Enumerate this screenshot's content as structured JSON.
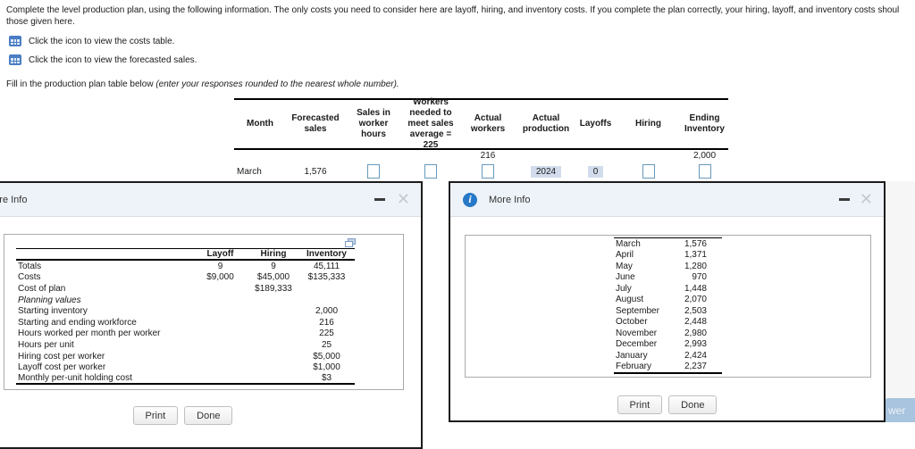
{
  "instructions": {
    "line1": "Complete the level production plan, using the following information. The only costs you need to consider here are layoff, hiring, and inventory costs. If you complete the plan correctly, your hiring, layoff, and inventory costs shoul",
    "line2": "those given here.",
    "costs_link": "Click the icon to view the costs table.",
    "sales_link": "Click the icon to view the forecasted sales.",
    "fill_prefix": "Fill in the production plan table below ",
    "fill_italic": "(enter your responses rounded to the nearest whole number)."
  },
  "production_table": {
    "columns": [
      {
        "label": "Month"
      },
      {
        "label": "Forecasted\nsales"
      },
      {
        "label": "Sales in\nworker\nhours"
      },
      {
        "label": "Workers\nneeded to\nmeet sales\naverage = 225"
      },
      {
        "label": "Actual\nworkers"
      },
      {
        "label": "Actual\nproduction"
      },
      {
        "label": "Layoffs"
      },
      {
        "label": "Hiring"
      },
      {
        "label": "Ending\nInventory"
      }
    ],
    "row": {
      "month": "March",
      "forecasted_sales": "1,576",
      "actual_workers_given": "216",
      "actual_production": "2024",
      "layoffs": "0",
      "ending_inventory_given": "2,000"
    }
  },
  "costs_popup": {
    "title": "More Info",
    "table": {
      "headers": [
        "Layoff",
        "Hiring",
        "Inventory"
      ],
      "rows": [
        {
          "label": "Totals",
          "layoff": "9",
          "hiring": "9",
          "inventory": "45,111"
        },
        {
          "label": "Costs",
          "layoff": "$9,000",
          "hiring": "$45,000",
          "inventory": "$135,333"
        },
        {
          "label": "Cost of plan",
          "layoff": "",
          "hiring": "$189,333",
          "inventory": ""
        },
        {
          "label": "Planning values",
          "layoff": "",
          "hiring": "",
          "inventory": ""
        },
        {
          "label": "Starting inventory",
          "layoff": "",
          "hiring": "",
          "inventory": "2,000"
        },
        {
          "label": "Starting and ending workforce",
          "layoff": "",
          "hiring": "",
          "inventory": "216"
        },
        {
          "label": "Hours worked per month per worker",
          "layoff": "",
          "hiring": "",
          "inventory": "225"
        },
        {
          "label": "Hours per unit",
          "layoff": "",
          "hiring": "",
          "inventory": "25"
        },
        {
          "label": "Hiring cost per worker",
          "layoff": "",
          "hiring": "",
          "inventory": "$5,000"
        },
        {
          "label": "Layoff cost per worker",
          "layoff": "",
          "hiring": "",
          "inventory": "$1,000"
        },
        {
          "label": "Monthly per-unit holding cost",
          "layoff": "",
          "hiring": "",
          "inventory": "$3"
        }
      ]
    },
    "print_label": "Print",
    "done_label": "Done"
  },
  "forecast_popup": {
    "title": "More Info",
    "rows": [
      {
        "month": "March",
        "value": "1,576"
      },
      {
        "month": "April",
        "value": "1,371"
      },
      {
        "month": "May",
        "value": "1,280"
      },
      {
        "month": "June",
        "value": "970"
      },
      {
        "month": "July",
        "value": "1,448"
      },
      {
        "month": "August",
        "value": "2,070"
      },
      {
        "month": "September",
        "value": "2,503"
      },
      {
        "month": "October",
        "value": "2,448"
      },
      {
        "month": "November",
        "value": "2,980"
      },
      {
        "month": "December",
        "value": "2,993"
      },
      {
        "month": "January",
        "value": "2,424"
      },
      {
        "month": "February",
        "value": "2,237"
      }
    ],
    "print_label": "Print",
    "done_label": "Done"
  },
  "check_button": {
    "visible_text": "wer"
  },
  "colors": {
    "accent_blue": "#4a7dc4",
    "highlight_cell": "#d2dcec",
    "titlebar": "#eef3f9",
    "check_button": "#a8c4de"
  }
}
